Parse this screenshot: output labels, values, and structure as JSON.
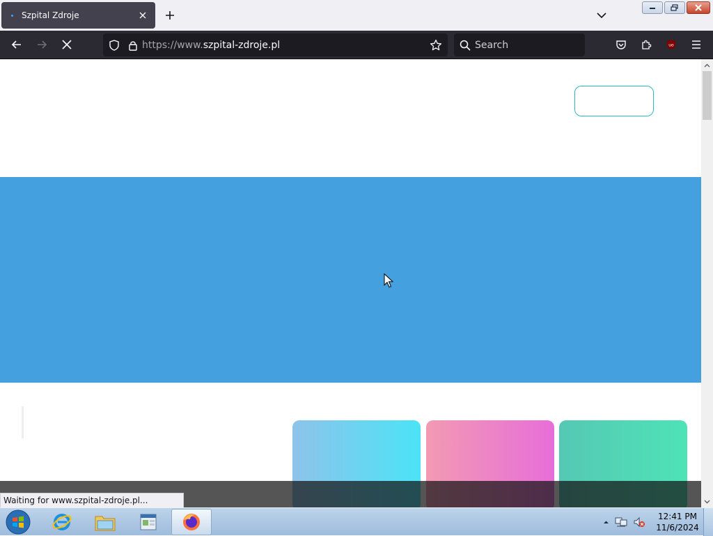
{
  "browser": {
    "tab": {
      "title": "Szpital Zdroje"
    },
    "url": {
      "prefix": "https://www.",
      "domain": "szpital-zdroje.pl"
    },
    "search": {
      "placeholder": "Search"
    },
    "status": "Waiting for www.szpital-zdroje.pl..."
  },
  "page": {
    "hero_color": "#45a0df",
    "header_button_border": "#2bb8c4",
    "cards": [
      {
        "gradient": [
          "#8ec3ea",
          "#4be3f7"
        ]
      },
      {
        "gradient": [
          "#f29ab2",
          "#e76ed9"
        ]
      },
      {
        "gradient": [
          "#55c8b4",
          "#4ee3b7"
        ]
      }
    ]
  },
  "taskbar": {
    "apps": [
      "internet-explorer-icon",
      "file-explorer-icon",
      "control-panel-icon",
      "firefox-icon"
    ],
    "clock": {
      "time": "12:41 PM",
      "date": "11/6/2024"
    }
  }
}
